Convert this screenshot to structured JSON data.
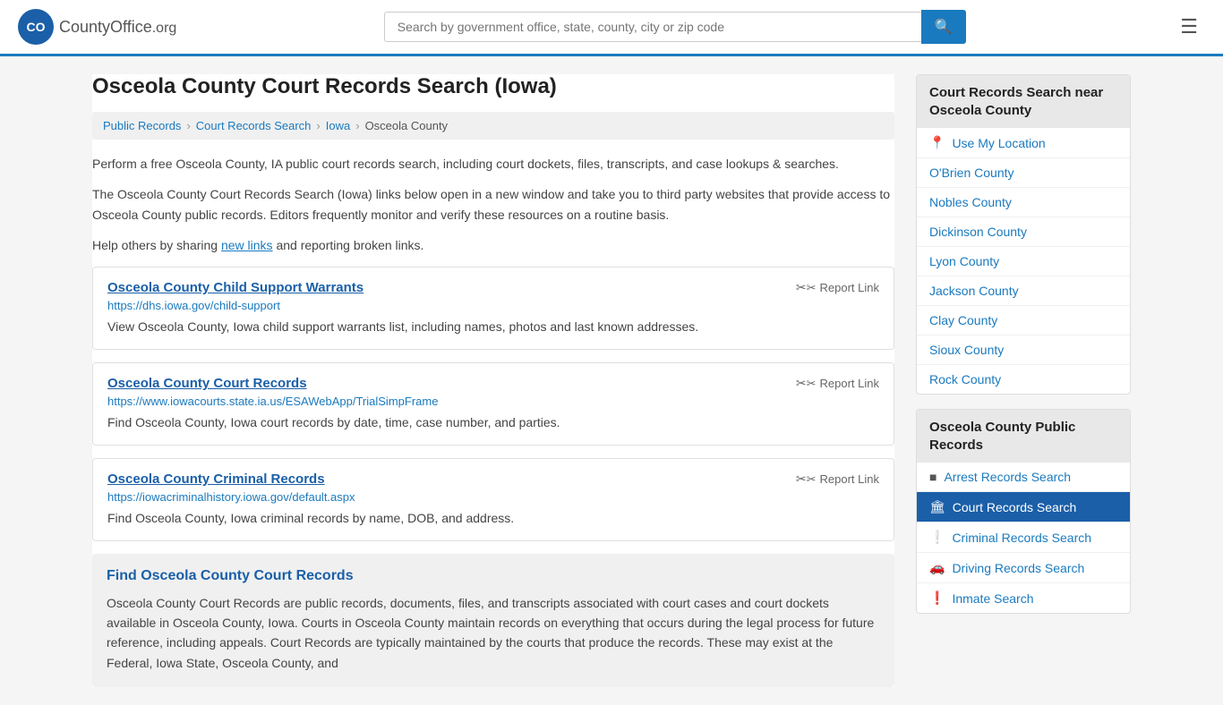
{
  "header": {
    "logo_text": "CountyOffice",
    "logo_tld": ".org",
    "search_placeholder": "Search by government office, state, county, city or zip code"
  },
  "page": {
    "title": "Osceola County Court Records Search (Iowa)",
    "breadcrumbs": [
      {
        "label": "Public Records",
        "href": "#"
      },
      {
        "label": "Court Records Search",
        "href": "#"
      },
      {
        "label": "Iowa",
        "href": "#"
      },
      {
        "label": "Osceola County",
        "href": "#"
      }
    ],
    "description1": "Perform a free Osceola County, IA public court records search, including court dockets, files, transcripts, and case lookups & searches.",
    "description2": "The Osceola County Court Records Search (Iowa) links below open in a new window and take you to third party websites that provide access to Osceola County public records. Editors frequently monitor and verify these resources on a routine basis.",
    "description3_prefix": "Help others by sharing ",
    "description3_link": "new links",
    "description3_suffix": " and reporting broken links."
  },
  "results": [
    {
      "title": "Osceola County Child Support Warrants",
      "url": "https://dhs.iowa.gov/child-support",
      "description": "View Osceola County, Iowa child support warrants list, including names, photos and last known addresses.",
      "report_label": "Report Link"
    },
    {
      "title": "Osceola County Court Records",
      "url": "https://www.iowacourts.state.ia.us/ESAWebApp/TrialSimpFrame",
      "description": "Find Osceola County, Iowa court records by date, time, case number, and parties.",
      "report_label": "Report Link"
    },
    {
      "title": "Osceola County Criminal Records",
      "url": "https://iowacriminalhistory.iowa.gov/default.aspx",
      "description": "Find Osceola County, Iowa criminal records by name, DOB, and address.",
      "report_label": "Report Link"
    }
  ],
  "find_section": {
    "title": "Find Osceola County Court Records",
    "text": "Osceola County Court Records are public records, documents, files, and transcripts associated with court cases and court dockets available in Osceola County, Iowa. Courts in Osceola County maintain records on everything that occurs during the legal process for future reference, including appeals. Court Records are typically maintained by the courts that produce the records. These may exist at the Federal, Iowa State, Osceola County, and"
  },
  "sidebar": {
    "nearby_header": "Court Records Search near Osceola County",
    "nearby_items": [
      {
        "label": "Use My Location",
        "type": "location"
      },
      {
        "label": "O'Brien County"
      },
      {
        "label": "Nobles County"
      },
      {
        "label": "Dickinson County"
      },
      {
        "label": "Lyon County"
      },
      {
        "label": "Jackson County"
      },
      {
        "label": "Clay County"
      },
      {
        "label": "Sioux County"
      },
      {
        "label": "Rock County"
      }
    ],
    "public_records_header": "Osceola County Public Records",
    "public_records_items": [
      {
        "label": "Arrest Records Search",
        "icon": "arrest",
        "active": false
      },
      {
        "label": "Court Records Search",
        "icon": "court",
        "active": true
      },
      {
        "label": "Criminal Records Search",
        "icon": "criminal",
        "active": false
      },
      {
        "label": "Driving Records Search",
        "icon": "driving",
        "active": false
      },
      {
        "label": "Inmate Search",
        "icon": "inmate",
        "active": false
      }
    ]
  }
}
